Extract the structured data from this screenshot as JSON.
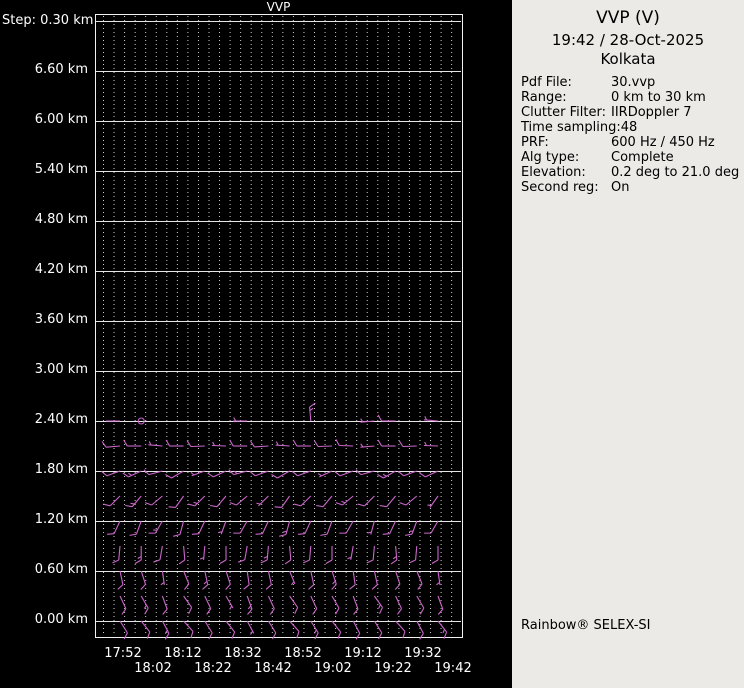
{
  "colors": {
    "chart_bg": "#000000",
    "grid": "#ffffff",
    "axis_text": "#ffffff",
    "barb": "#cc66cc",
    "panel_bg": "#ebeae6",
    "panel_text": "#000000"
  },
  "chart": {
    "title": "VVP",
    "step_label": "Step: 0.30 km",
    "y_labels": [
      "6.60 km",
      "6.00 km",
      "5.40 km",
      "4.80 km",
      "4.20 km",
      "3.60 km",
      "3.00 km",
      "2.40 km",
      "1.80 km",
      "1.20 km",
      "0.60 km",
      "0.00 km"
    ],
    "x_labels_row1": [
      "17:52",
      "18:12",
      "18:32",
      "18:52",
      "19:12",
      "19:32"
    ],
    "x_labels_row2": [
      "18:02",
      "18:22",
      "18:42",
      "19:02",
      "19:22",
      "19:42"
    ]
  },
  "chart_data": {
    "type": "scatter",
    "subtype": "wind-barb-time-height-profile",
    "title": "VVP",
    "x_tick_labels": [
      "17:52",
      "18:02",
      "18:12",
      "18:22",
      "18:32",
      "18:42",
      "18:52",
      "19:02",
      "19:12",
      "19:22",
      "19:32",
      "19:42"
    ],
    "y_tick_labels_km": [
      6.6,
      6.0,
      5.4,
      4.8,
      4.2,
      3.6,
      3.0,
      2.4,
      1.8,
      1.2,
      0.6,
      0.0
    ],
    "height_step_km": 0.3,
    "ylim_km": [
      0.0,
      7.2
    ],
    "units": {
      "speed": "kt",
      "direction": "deg"
    },
    "legend": "none",
    "grid": "dotted-vertical, solid-horizontal",
    "barb_rows": [
      {
        "height_km": 2.4,
        "cells": [
          [
            270,
            2
          ],
          [
            0,
            0
          ],
          null,
          null,
          null,
          null,
          [
            270,
            5
          ],
          null,
          null,
          [
            355,
            15
          ],
          null,
          null,
          [
            265,
            5
          ],
          [
            270,
            10
          ],
          null,
          [
            275,
            5
          ]
        ]
      },
      {
        "height_km": 2.1,
        "cells": [
          [
            265,
            10
          ],
          [
            270,
            10
          ],
          [
            275,
            5
          ],
          [
            270,
            10
          ],
          [
            268,
            10
          ],
          [
            272,
            5
          ],
          [
            270,
            10
          ],
          [
            266,
            10
          ],
          [
            274,
            5
          ],
          [
            270,
            10
          ],
          [
            268,
            10
          ],
          [
            272,
            10
          ],
          [
            265,
            5
          ],
          [
            270,
            10
          ],
          [
            268,
            10
          ],
          [
            272,
            5
          ]
        ]
      },
      {
        "height_km": 1.8,
        "cells": [
          [
            250,
            10
          ],
          [
            245,
            15
          ],
          [
            255,
            10
          ],
          [
            240,
            10
          ],
          [
            250,
            5
          ],
          [
            245,
            10
          ],
          [
            255,
            15
          ],
          [
            250,
            10
          ],
          [
            240,
            10
          ],
          [
            250,
            10
          ],
          [
            245,
            5
          ],
          [
            250,
            10
          ],
          [
            255,
            10
          ],
          [
            240,
            15
          ],
          [
            250,
            10
          ],
          [
            245,
            10
          ]
        ]
      },
      {
        "height_km": 1.5,
        "cells": [
          [
            225,
            10
          ],
          [
            220,
            15
          ],
          [
            230,
            10
          ],
          [
            215,
            10
          ],
          [
            225,
            15
          ],
          [
            220,
            10
          ],
          [
            230,
            10
          ],
          [
            225,
            5
          ],
          [
            215,
            10
          ],
          [
            225,
            10
          ],
          [
            220,
            10
          ],
          [
            230,
            15
          ],
          [
            225,
            10
          ],
          [
            220,
            10
          ],
          [
            230,
            10
          ],
          [
            215,
            5
          ]
        ]
      },
      {
        "height_km": 1.2,
        "cells": [
          [
            205,
            10
          ],
          [
            200,
            10
          ],
          [
            210,
            15
          ],
          [
            195,
            10
          ],
          [
            205,
            10
          ],
          [
            200,
            5
          ],
          [
            210,
            10
          ],
          [
            205,
            10
          ],
          [
            195,
            15
          ],
          [
            205,
            10
          ],
          [
            200,
            10
          ],
          [
            210,
            10
          ],
          [
            195,
            5
          ],
          [
            205,
            10
          ],
          [
            200,
            15
          ],
          [
            210,
            10
          ]
        ]
      },
      {
        "height_km": 0.9,
        "cells": [
          [
            185,
            10
          ],
          [
            180,
            15
          ],
          [
            190,
            10
          ],
          [
            175,
            10
          ],
          [
            185,
            5
          ],
          [
            180,
            10
          ],
          [
            190,
            10
          ],
          [
            185,
            15
          ],
          [
            175,
            10
          ],
          [
            185,
            10
          ],
          [
            180,
            10
          ],
          [
            190,
            5
          ],
          [
            185,
            10
          ],
          [
            175,
            15
          ],
          [
            185,
            10
          ],
          [
            180,
            10
          ]
        ]
      },
      {
        "height_km": 0.6,
        "cells": [
          [
            168,
            10
          ],
          [
            162,
            10
          ],
          [
            172,
            5
          ],
          [
            158,
            10
          ],
          [
            168,
            15
          ],
          [
            162,
            10
          ],
          [
            172,
            10
          ],
          [
            168,
            10
          ],
          [
            158,
            5
          ],
          [
            168,
            10
          ],
          [
            162,
            15
          ],
          [
            172,
            10
          ],
          [
            168,
            10
          ],
          [
            162,
            10
          ],
          [
            158,
            10
          ],
          [
            172,
            5
          ]
        ]
      },
      {
        "height_km": 0.3,
        "cells": [
          [
            155,
            10
          ],
          [
            150,
            15
          ],
          [
            160,
            10
          ],
          [
            145,
            10
          ],
          [
            155,
            10
          ],
          [
            150,
            5
          ],
          [
            160,
            15
          ],
          [
            155,
            10
          ],
          [
            145,
            10
          ],
          [
            155,
            10
          ],
          [
            150,
            10
          ],
          [
            160,
            10
          ],
          [
            145,
            15
          ],
          [
            155,
            10
          ],
          [
            150,
            10
          ],
          [
            160,
            10
          ]
        ]
      },
      {
        "height_km": 0.0,
        "cells": [
          [
            148,
            10
          ],
          [
            142,
            10
          ],
          [
            152,
            15
          ],
          [
            138,
            10
          ],
          [
            148,
            10
          ],
          [
            142,
            10
          ],
          [
            152,
            5
          ],
          [
            148,
            10
          ],
          [
            138,
            10
          ],
          [
            148,
            15
          ],
          [
            142,
            10
          ],
          [
            152,
            10
          ],
          [
            148,
            10
          ],
          [
            138,
            10
          ],
          [
            152,
            10
          ],
          [
            142,
            15
          ]
        ]
      }
    ]
  },
  "panel": {
    "title": "VVP (V)",
    "datetime": "19:42 / 28-Oct-2025",
    "site": "Kolkata",
    "fields": [
      {
        "label": "Pdf File:",
        "value": "30.vvp"
      },
      {
        "label": "Range:",
        "value": "0 km to 30 km"
      },
      {
        "label": "Clutter Filter:",
        "value": "IIRDoppler 7"
      },
      {
        "label": "Time sampling:",
        "value": "48"
      },
      {
        "label": "PRF:",
        "value": "600 Hz / 450 Hz"
      },
      {
        "label": "Alg type:",
        "value": "Complete"
      },
      {
        "label": "Elevation:",
        "value": "0.2 deg to 21.0 deg"
      },
      {
        "label": "Second reg:",
        "value": "On"
      }
    ],
    "footer": "Rainbow® SELEX-SI"
  }
}
